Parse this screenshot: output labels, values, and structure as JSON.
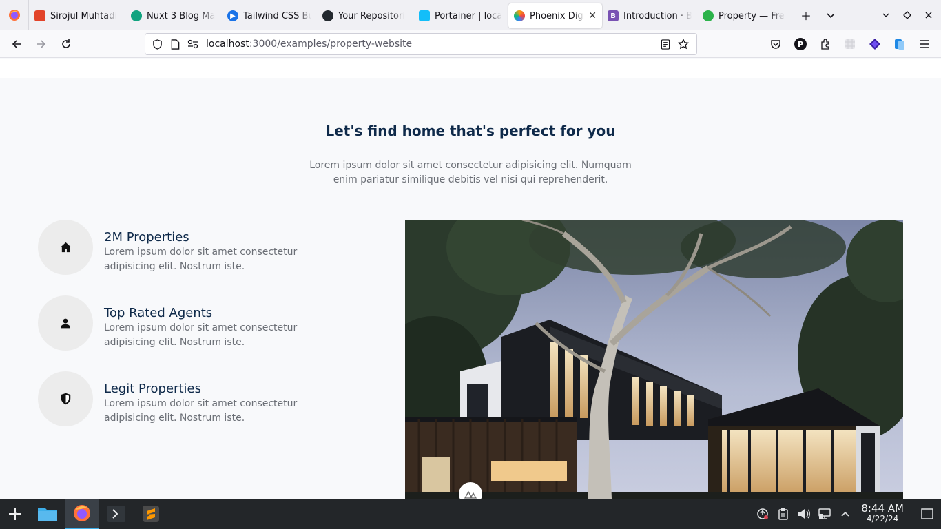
{
  "browser": {
    "tabs": [
      {
        "label": "Sirojul Muhtadi",
        "favicon_color": "#e24329"
      },
      {
        "label": "Nuxt 3 Blog Ma",
        "favicon_color": "#10a37f"
      },
      {
        "label": "Tailwind CSS Bu",
        "favicon_color": "#1a73e8"
      },
      {
        "label": "Your Repositori",
        "favicon_color": "#24292f"
      },
      {
        "label": "Portainer | loca",
        "favicon_color": "#13bef9"
      },
      {
        "label": "Phoenix Digi",
        "favicon_color": "#f59e0b",
        "active": true
      },
      {
        "label": "Introduction · B",
        "favicon_color": "#7952b3",
        "glyph": "B"
      },
      {
        "label": "Property — Fre",
        "favicon_color": "#2cb34a"
      }
    ],
    "url_host": "localhost",
    "url_path": ":3000/examples/property-website"
  },
  "page": {
    "heading": "Let's find home that's perfect for you",
    "lede": "Lorem ipsum dolor sit amet consectetur adipisicing elit. Numquam enim pariatur similique debitis vel nisi qui reprehenderit.",
    "features": [
      {
        "title": "2M Properties",
        "description": "Lorem ipsum dolor sit amet consectetur adipisicing elit. Nostrum iste.",
        "icon": "home-icon"
      },
      {
        "title": "Top Rated Agents",
        "description": "Lorem ipsum dolor sit amet consectetur adipisicing elit. Nostrum iste.",
        "icon": "person-icon"
      },
      {
        "title": "Legit Properties",
        "description": "Lorem ipsum dolor sit amet consectetur adipisicing elit. Nostrum iste.",
        "icon": "shield-icon"
      }
    ],
    "image_subject": "modern house at dusk"
  },
  "taskbar": {
    "time": "8:44 AM",
    "date": "4/22/24"
  },
  "colors": {
    "heading": "#0f2a4a",
    "body_text": "#6b6f76",
    "page_bg": "#f8f9fb",
    "taskbar_bg": "#232629"
  }
}
